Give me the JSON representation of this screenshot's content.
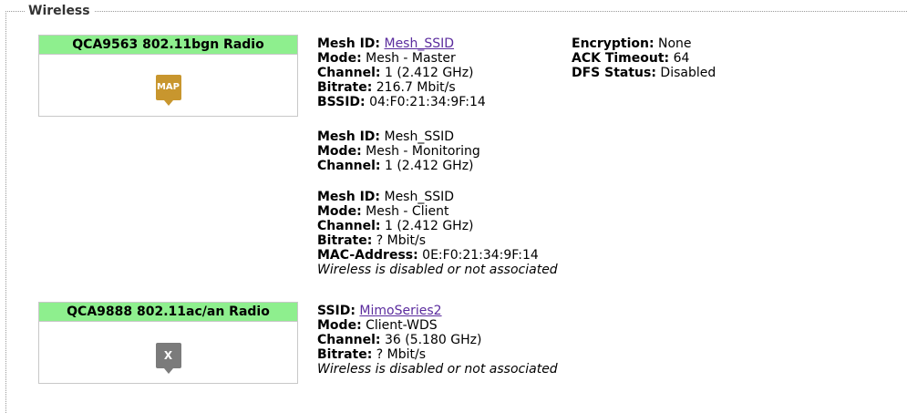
{
  "section": {
    "legend": "Wireless"
  },
  "radios": [
    {
      "title": "QCA9563 802.11bgn Radio",
      "badge": {
        "text": "MAP",
        "color": "#c8962e",
        "icon": "map-badge-icon"
      },
      "right_info": {
        "encryption_label": "Encryption:",
        "encryption_value": "None",
        "ack_label": "ACK Timeout:",
        "ack_value": "64",
        "dfs_label": "DFS Status:",
        "dfs_value": "Disabled"
      },
      "networks": [
        {
          "mesh_id_label": "Mesh ID:",
          "mesh_id": "Mesh_SSID",
          "mode_label": "Mode:",
          "mode": "Mesh - Master",
          "channel_label": "Channel:",
          "channel": "1 (2.412 GHz)",
          "bitrate_label": "Bitrate:",
          "bitrate": "216.7 Mbit/s",
          "bssid_label": "BSSID:",
          "bssid": "04:F0:21:34:9F:14"
        },
        {
          "mesh_id_label": "Mesh ID:",
          "mesh_id": "Mesh_SSID",
          "mode_label": "Mode:",
          "mode": "Mesh - Monitoring",
          "channel_label": "Channel:",
          "channel": "1 (2.412 GHz)"
        },
        {
          "mesh_id_label": "Mesh ID:",
          "mesh_id": "Mesh_SSID",
          "mode_label": "Mode:",
          "mode": "Mesh - Client",
          "channel_label": "Channel:",
          "channel": "1 (2.412 GHz)",
          "bitrate_label": "Bitrate:",
          "bitrate": "? Mbit/s",
          "mac_label": "MAC-Address:",
          "mac": "0E:F0:21:34:9F:14",
          "status": "Wireless is disabled or not associated"
        }
      ]
    },
    {
      "title": "QCA9888 802.11ac/an Radio",
      "badge": {
        "text": "X",
        "color": "#7b7b7b",
        "icon": "disabled-badge-icon"
      },
      "networks": [
        {
          "ssid_label": "SSID:",
          "ssid": "MimoSeries2",
          "mode_label": "Mode:",
          "mode": "Client-WDS",
          "channel_label": "Channel:",
          "channel": "36 (5.180 GHz)",
          "bitrate_label": "Bitrate:",
          "bitrate": "? Mbit/s",
          "status": "Wireless is disabled or not associated"
        }
      ]
    }
  ]
}
